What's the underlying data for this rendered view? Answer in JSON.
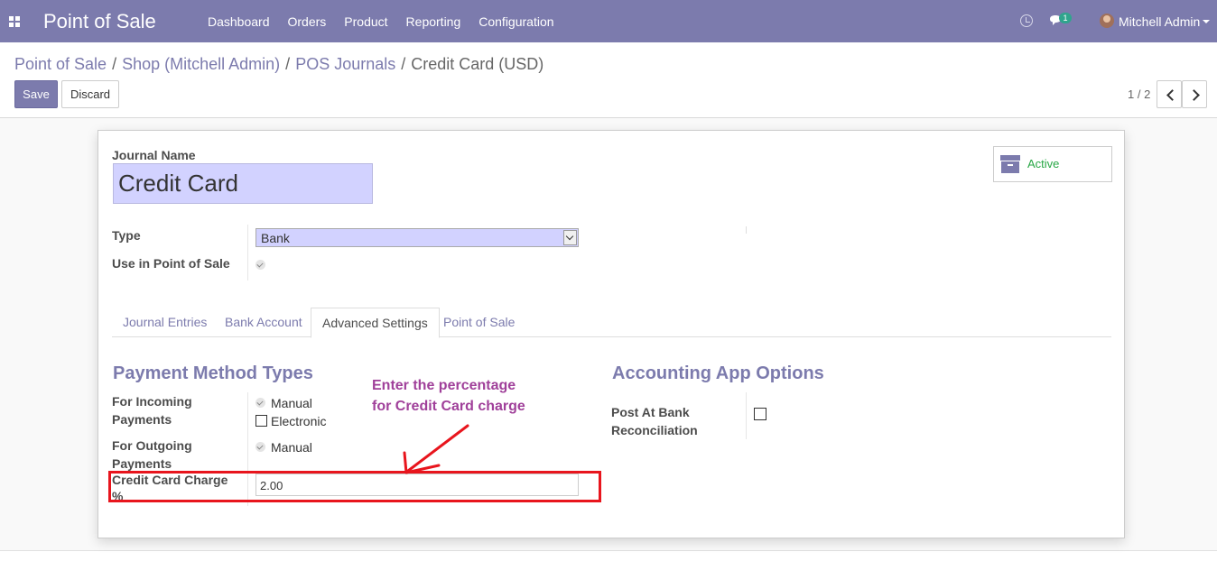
{
  "navbar": {
    "brand": "Point of Sale",
    "menu": [
      "Dashboard",
      "Orders",
      "Product",
      "Reporting",
      "Configuration"
    ],
    "chat_badge": "1",
    "user_name": "Mitchell Admin",
    "icons": [
      "apps-icon",
      "clock-icon",
      "chat-icon",
      "avatar",
      "caret-down-icon"
    ]
  },
  "breadcrumb": {
    "items": [
      "Point of Sale",
      "Shop (Mitchell Admin)",
      "POS Journals"
    ],
    "current": "Credit Card (USD)",
    "separator": "/"
  },
  "toolbar": {
    "save_label": "Save",
    "discard_label": "Discard",
    "pager": "1 / 2"
  },
  "form": {
    "journal_name_label": "Journal Name",
    "journal_name": "Credit Card",
    "active_label": "Active",
    "type_label": "Type",
    "type_value": "Bank",
    "use_pos_label": "Use in Point of Sale",
    "use_pos_checked": true,
    "tabs": [
      "Journal Entries",
      "Bank Account",
      "Advanced Settings",
      "Point of Sale"
    ],
    "active_tab": "Advanced Settings",
    "payment_method_title": "Payment Method Types",
    "incoming_label_1": "For Incoming",
    "incoming_label_2": "Payments",
    "incoming_manual": "Manual",
    "incoming_electronic": "Electronic",
    "outgoing_label_1": "For Outgoing",
    "outgoing_label_2": "Payments",
    "outgoing_manual": "Manual",
    "cc_label_1": "Credit Card Charge",
    "cc_label_2": "%",
    "cc_value": "2.00",
    "accounting_title": "Accounting App Options",
    "post_label_1": "Post At Bank",
    "post_label_2": "Reconciliation",
    "post_checked": false
  },
  "annotation": {
    "line1": "Enter the percentage",
    "line2": "for  Credit Card charge",
    "color": "#a0409a",
    "box_color": "#e8151d"
  },
  "colors": {
    "brand": "#7c7bad",
    "active_green": "#28a745",
    "field_highlight": "#d2d2ff"
  }
}
